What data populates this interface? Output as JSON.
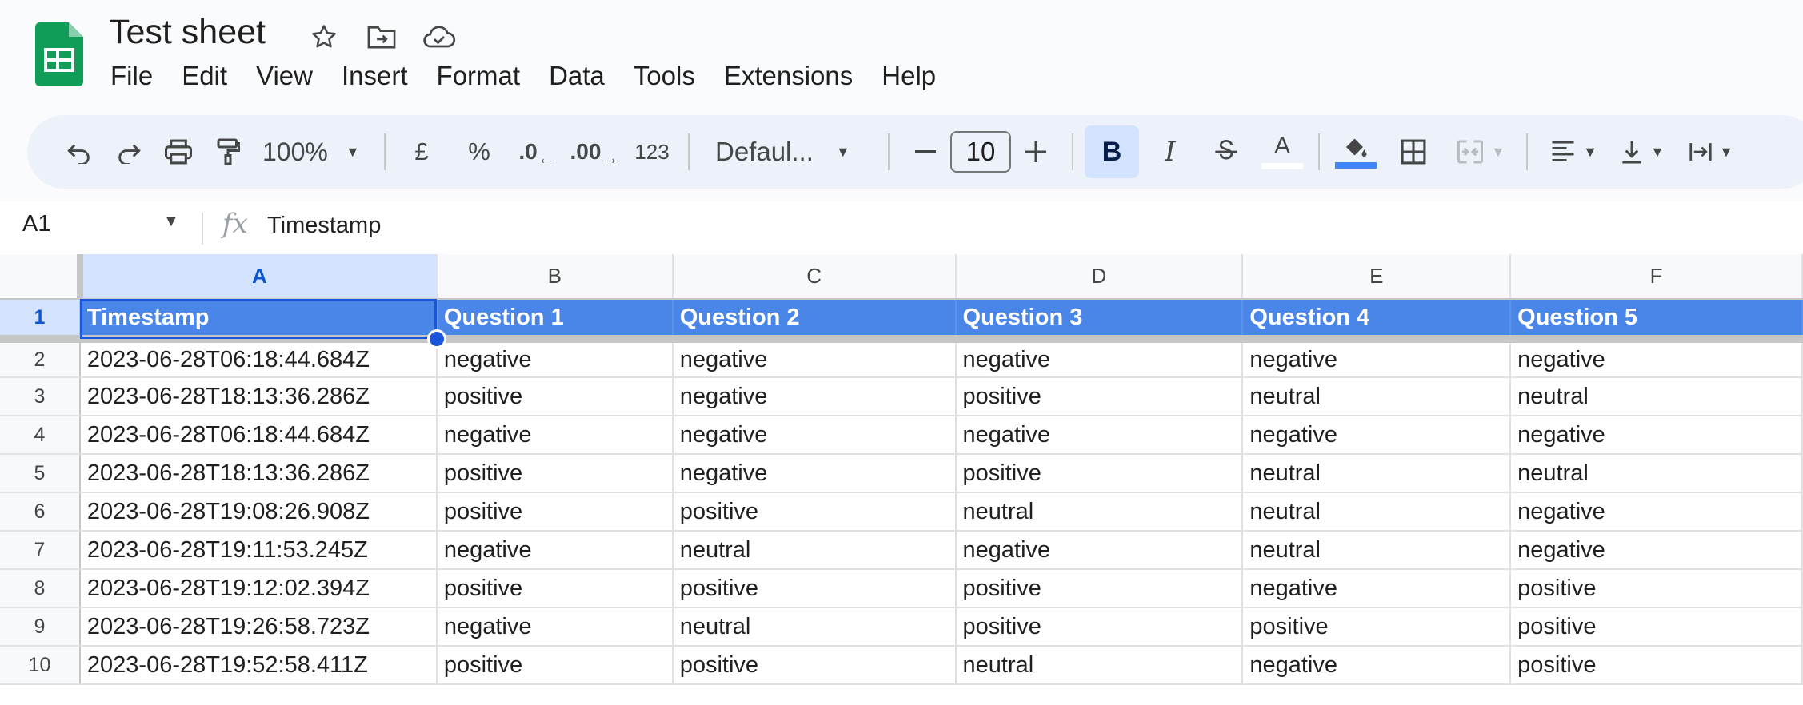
{
  "app": {
    "title": "Test sheet",
    "menu": [
      "File",
      "Edit",
      "View",
      "Insert",
      "Format",
      "Data",
      "Tools",
      "Extensions",
      "Help"
    ]
  },
  "toolbar": {
    "zoom": "100%",
    "currency": "£",
    "percent": "%",
    "decrease_decimal": ".0",
    "increase_decimal": ".00",
    "number_format": "123",
    "font": "Defaul...",
    "font_size": "10",
    "bold": "B",
    "italic": "I",
    "text_color_glyph": "A",
    "fill_color": "#4285f4"
  },
  "formula_bar": {
    "name_box": "A1",
    "fx": "fx",
    "content": "Timestamp"
  },
  "grid": {
    "columns": [
      "A",
      "B",
      "C",
      "D",
      "E",
      "F"
    ],
    "header_row_number": "1",
    "headers": [
      "Timestamp",
      "Question 1",
      "Question 2",
      "Question 3",
      "Question 4",
      "Question 5"
    ],
    "header_fill": "#4a86e8",
    "rows": [
      {
        "n": "2",
        "cells": [
          "2023-06-28T06:18:44.684Z",
          "negative",
          "negative",
          "negative",
          "negative",
          "negative"
        ]
      },
      {
        "n": "3",
        "cells": [
          "2023-06-28T18:13:36.286Z",
          "positive",
          "negative",
          "positive",
          "neutral",
          "neutral"
        ]
      },
      {
        "n": "4",
        "cells": [
          "2023-06-28T06:18:44.684Z",
          "negative",
          "negative",
          "negative",
          "negative",
          "negative"
        ]
      },
      {
        "n": "5",
        "cells": [
          "2023-06-28T18:13:36.286Z",
          "positive",
          "negative",
          "positive",
          "neutral",
          "neutral"
        ]
      },
      {
        "n": "6",
        "cells": [
          "2023-06-28T19:08:26.908Z",
          "positive",
          "positive",
          "neutral",
          "neutral",
          "negative"
        ]
      },
      {
        "n": "7",
        "cells": [
          "2023-06-28T19:11:53.245Z",
          "negative",
          "neutral",
          "negative",
          "neutral",
          "negative"
        ]
      },
      {
        "n": "8",
        "cells": [
          "2023-06-28T19:12:02.394Z",
          "positive",
          "positive",
          "positive",
          "negative",
          "positive"
        ]
      },
      {
        "n": "9",
        "cells": [
          "2023-06-28T19:26:58.723Z",
          "negative",
          "neutral",
          "positive",
          "positive",
          "positive"
        ]
      },
      {
        "n": "10",
        "cells": [
          "2023-06-28T19:52:58.411Z",
          "positive",
          "positive",
          "neutral",
          "negative",
          "positive"
        ]
      }
    ]
  }
}
